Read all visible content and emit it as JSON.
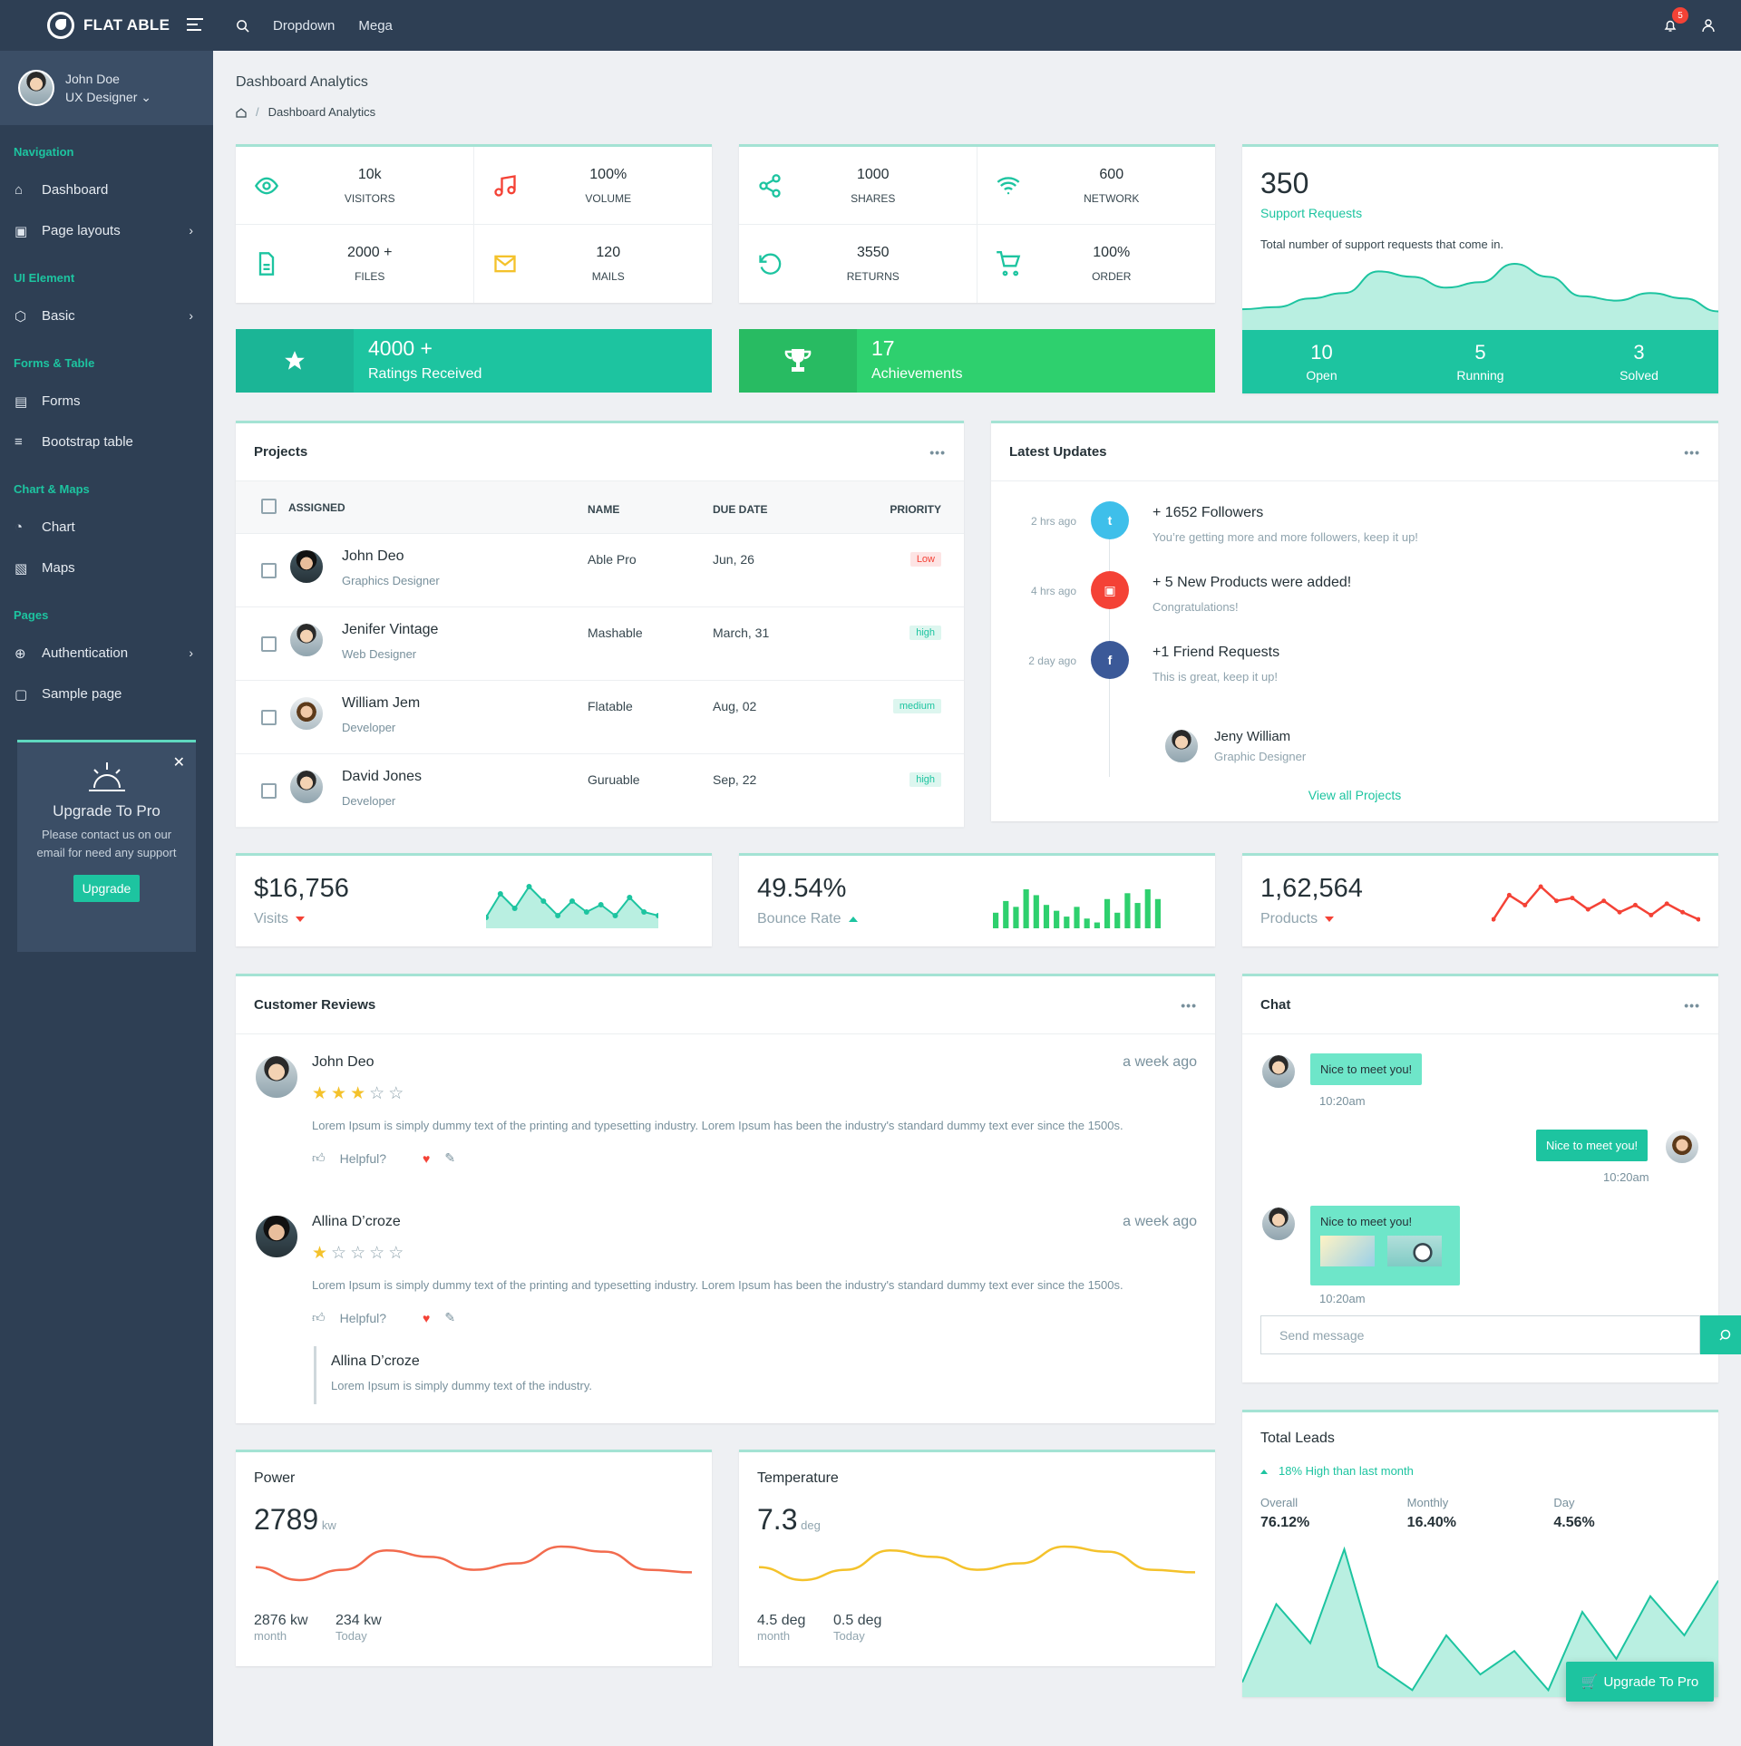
{
  "app": {
    "name": "FLAT ABLE"
  },
  "topnav": {
    "items": [
      "Dropdown",
      "Mega"
    ],
    "notif_count": "5"
  },
  "user": {
    "name": "John Doe",
    "role": "UX Designer"
  },
  "sidebar": {
    "sections": [
      {
        "title": "Navigation",
        "items": [
          {
            "label": "Dashboard",
            "icon": "home-icon"
          },
          {
            "label": "Page layouts",
            "icon": "layout-icon",
            "chev": true
          }
        ]
      },
      {
        "title": "UI Element",
        "items": [
          {
            "label": "Basic",
            "icon": "box-icon",
            "chev": true
          }
        ]
      },
      {
        "title": "Forms & Table",
        "items": [
          {
            "label": "Forms",
            "icon": "file-icon"
          },
          {
            "label": "Bootstrap table",
            "icon": "list-icon"
          }
        ]
      },
      {
        "title": "Chart & Maps",
        "items": [
          {
            "label": "Chart",
            "icon": "pie-icon"
          },
          {
            "label": "Maps",
            "icon": "map-icon"
          }
        ]
      },
      {
        "title": "Pages",
        "items": [
          {
            "label": "Authentication",
            "icon": "lock-icon",
            "chev": true
          },
          {
            "label": "Sample page",
            "icon": "sidebar-icon"
          }
        ]
      }
    ],
    "pro": {
      "title": "Upgrade To Pro",
      "text": "Please contact us on our email for need any support",
      "button": "Upgrade"
    }
  },
  "page": {
    "title": "Dashboard Analytics",
    "breadcrumb": "Dashboard Analytics"
  },
  "stats_a": [
    {
      "value": "10k",
      "label": "VISITORS",
      "color": "#1dc4a0"
    },
    {
      "value": "100%",
      "label": "VOLUME",
      "color": "#f44236"
    },
    {
      "value": "2000 +",
      "label": "FILES",
      "color": "#1dc4a0"
    },
    {
      "value": "120",
      "label": "MAILS",
      "color": "#f4c22b"
    }
  ],
  "stats_b": [
    {
      "value": "1000",
      "label": "SHARES",
      "color": "#1dc4a0"
    },
    {
      "value": "600",
      "label": "NETWORK",
      "color": "#1dc4a0"
    },
    {
      "value": "3550",
      "label": "RETURNS",
      "color": "#1dc4a0"
    },
    {
      "value": "100%",
      "label": "ORDER",
      "color": "#1dc4a0"
    }
  ],
  "support": {
    "value": "350",
    "label": "Support Requests",
    "desc": "Total number of support requests that come in.",
    "footer": [
      {
        "value": "10",
        "label": "Open"
      },
      {
        "value": "5",
        "label": "Running"
      },
      {
        "value": "3",
        "label": "Solved"
      }
    ]
  },
  "banners": [
    {
      "value": "4000 +",
      "label": "Ratings Received"
    },
    {
      "value": "17",
      "label": "Achievements"
    }
  ],
  "projects": {
    "title": "Projects",
    "headers": {
      "assigned": "ASSIGNED",
      "name": "NAME",
      "due": "DUE DATE",
      "priority": "PRIORITY"
    },
    "rows": [
      {
        "person": "John Deo",
        "role": "Graphics Designer",
        "project": "Able Pro",
        "due": "Jun, 26",
        "priority": "Low",
        "cls": "low"
      },
      {
        "person": "Jenifer Vintage",
        "role": "Web Designer",
        "project": "Mashable",
        "due": "March, 31",
        "priority": "high",
        "cls": "high"
      },
      {
        "person": "William Jem",
        "role": "Developer",
        "project": "Flatable",
        "due": "Aug, 02",
        "priority": "medium",
        "cls": "high"
      },
      {
        "person": "David Jones",
        "role": "Developer",
        "project": "Guruable",
        "due": "Sep, 22",
        "priority": "high",
        "cls": "high"
      }
    ]
  },
  "updates": {
    "title": "Latest Updates",
    "items": [
      {
        "time": "2 hrs ago",
        "title": "+ 1652 Followers",
        "text": "You’re getting more and more followers, keep it up!",
        "color": "#3ebfea",
        "icon": "twitter-icon"
      },
      {
        "time": "4 hrs ago",
        "title": "+ 5 New Products were added!",
        "text": "Congratulations!",
        "color": "#f44236",
        "icon": "briefcase-icon"
      },
      {
        "time": "2 day ago",
        "title": "+1 Friend Requests",
        "text": "This is great, keep it up!",
        "color": "#3b5998",
        "icon": "facebook-icon"
      }
    ],
    "person": {
      "name": "Jeny William",
      "role": "Graphic Designer"
    },
    "link": "View all Projects"
  },
  "minis": [
    {
      "value": "$16,756",
      "label": "Visits",
      "trend": "down"
    },
    {
      "value": "49.54%",
      "label": "Bounce Rate",
      "trend": "up"
    },
    {
      "value": "1,62,564",
      "label": "Products",
      "trend": "down"
    }
  ],
  "reviews": {
    "title": "Customer Reviews",
    "items": [
      {
        "name": "John Deo",
        "time": "a week ago",
        "stars": 3,
        "text": "Lorem Ipsum is simply dummy text of the printing and typesetting industry. Lorem Ipsum has been the industry's standard dummy text ever since the 1500s.",
        "helpful": "Helpful?"
      },
      {
        "name": "Allina D’croze",
        "time": "a week ago",
        "stars": 1,
        "text": "Lorem Ipsum is simply dummy text of the printing and typesetting industry. Lorem Ipsum has been the industry's standard dummy text ever since the 1500s.",
        "helpful": "Helpful?"
      }
    ],
    "reply": {
      "name": "Allina D’croze",
      "text": "Lorem Ipsum is simply dummy text of the industry."
    }
  },
  "chat": {
    "title": "Chat",
    "messages": [
      {
        "text": "Nice to meet you!",
        "time": "10:20am"
      },
      {
        "text": "Nice to meet you!",
        "time": "10:20am"
      },
      {
        "text": "Nice to meet you!",
        "time": "10:20am"
      }
    ],
    "placeholder": "Send message"
  },
  "power": {
    "title": "Power",
    "value": "2789",
    "unit": "kw",
    "a": "2876 kw",
    "a_l": "month",
    "b": "234 kw",
    "b_l": "Today"
  },
  "temp": {
    "title": "Temperature",
    "value": "7.3",
    "unit": "deg",
    "a": "4.5 deg",
    "a_l": "month",
    "b": "0.5 deg",
    "b_l": "Today"
  },
  "leads": {
    "title": "Total Leads",
    "trend": "18% High than last month",
    "cols": [
      {
        "label": "Overall",
        "value": "76.12%"
      },
      {
        "label": "Monthly",
        "value": "16.40%"
      },
      {
        "label": "Day",
        "value": "4.56%"
      }
    ]
  },
  "float_button": "Upgrade To Pro",
  "colors": {
    "primary": "#1dc4a0",
    "dark": "#2e3f54",
    "danger": "#f44236",
    "warning": "#f4c22b",
    "success": "#2ed06e"
  },
  "chart_data": [
    {
      "type": "area",
      "name": "support-requests",
      "values": [
        20,
        22,
        30,
        35,
        55,
        50,
        40,
        45,
        62,
        50,
        32,
        28,
        35,
        30,
        18
      ]
    },
    {
      "type": "area",
      "name": "visits",
      "values": [
        5,
        18,
        10,
        22,
        14,
        6,
        14,
        8,
        12,
        6,
        16,
        8,
        6
      ]
    },
    {
      "type": "bar",
      "name": "bounce-rate",
      "values": [
        40,
        70,
        55,
        100,
        85,
        60,
        45,
        30,
        55,
        25,
        15,
        75,
        40,
        90,
        65,
        100,
        75
      ]
    },
    {
      "type": "line",
      "name": "products",
      "values": [
        5,
        22,
        15,
        28,
        18,
        20,
        12,
        18,
        10,
        15,
        8,
        16,
        10,
        5
      ]
    },
    {
      "type": "line",
      "name": "power",
      "values": [
        22,
        12,
        20,
        35,
        30,
        20,
        25,
        38,
        34,
        20,
        18
      ]
    },
    {
      "type": "line",
      "name": "temperature",
      "values": [
        22,
        12,
        20,
        35,
        30,
        20,
        25,
        38,
        34,
        20,
        18
      ]
    },
    {
      "type": "area",
      "name": "total-leads",
      "values": [
        10,
        60,
        35,
        95,
        20,
        5,
        40,
        15,
        30,
        5,
        55,
        25,
        65,
        40,
        75
      ]
    }
  ]
}
